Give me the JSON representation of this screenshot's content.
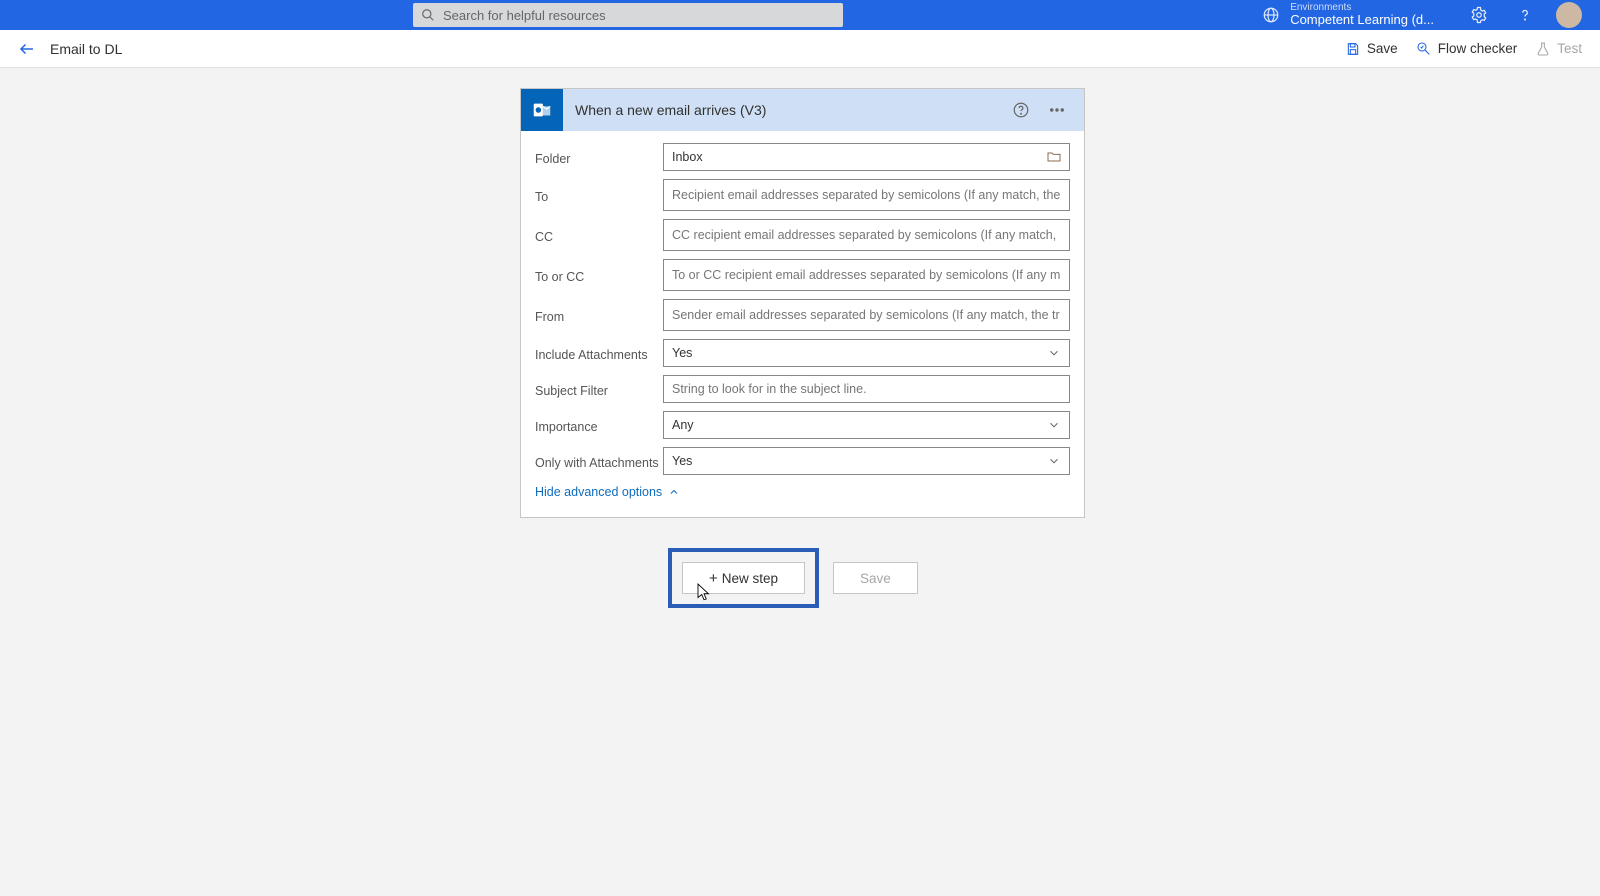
{
  "header": {
    "search_placeholder": "Search for helpful resources",
    "env_label": "Environments",
    "env_name": "Competent Learning (d..."
  },
  "subheader": {
    "flow_name": "Email to DL",
    "save": "Save",
    "flow_checker": "Flow checker",
    "test": "Test"
  },
  "trigger": {
    "title": "When a new email arrives (V3)",
    "adv_toggle": "Hide advanced options",
    "fields": {
      "folder_label": "Folder",
      "folder_value": "Inbox",
      "to_label": "To",
      "to_placeholder": "Recipient email addresses separated by semicolons (If any match, the",
      "cc_label": "CC",
      "cc_placeholder": "CC recipient email addresses separated by semicolons (If any match,",
      "tocc_label": "To or CC",
      "tocc_placeholder": "To or CC recipient email addresses separated by semicolons (If any m",
      "from_label": "From",
      "from_placeholder": "Sender email addresses separated by semicolons (If any match, the tr",
      "incatt_label": "Include Attachments",
      "incatt_value": "Yes",
      "subj_label": "Subject Filter",
      "subj_placeholder": "String to look for in the subject line.",
      "imp_label": "Importance",
      "imp_value": "Any",
      "onlyatt_label": "Only with Attachments",
      "onlyatt_value": "Yes"
    }
  },
  "buttons": {
    "new_step": "New step",
    "save": "Save"
  }
}
